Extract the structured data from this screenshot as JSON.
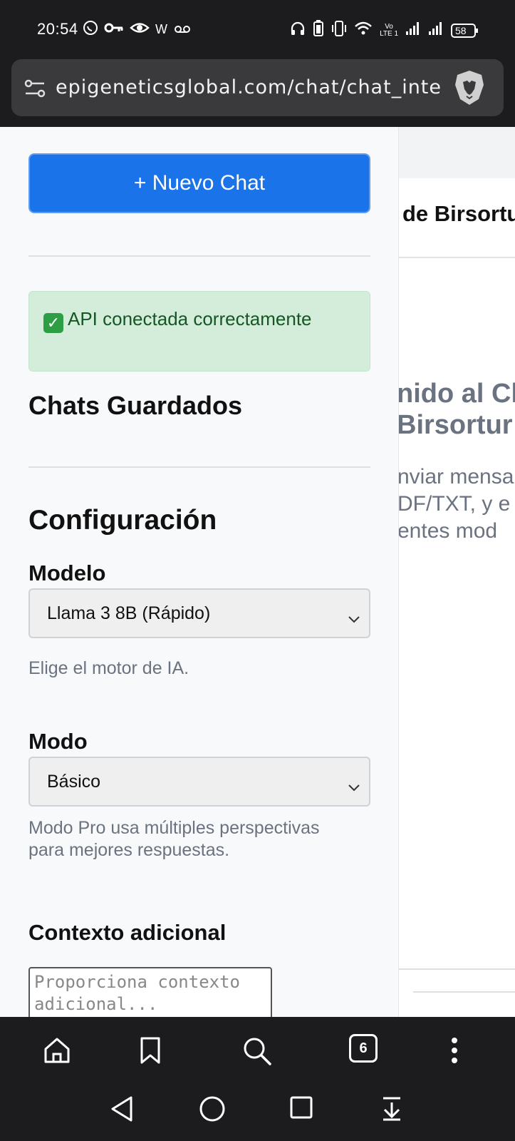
{
  "status_bar": {
    "time": "20:54",
    "left_icons": [
      "whatsapp-icon",
      "key-icon",
      "eye-icon",
      "w-letter-icon",
      "voicemail-icon"
    ],
    "w_letter": "W",
    "volte": "Vo",
    "lte": "LTE 1",
    "battery": "58"
  },
  "browser": {
    "url": "epigeneticsglobal.com/chat/chat_inte",
    "tab_count": "6"
  },
  "sidebar": {
    "new_chat_label": "+ Nuevo Chat",
    "api_status": "API conectada correctamente",
    "api_status_check": "✓",
    "saved_chats_heading": "Chats Guardados",
    "config_heading": "Configuración",
    "model_label": "Modelo",
    "model_selected": "Llama 3 8B (Rápido)",
    "model_help": "Elige el motor de IA.",
    "mode_label": "Modo",
    "mode_selected": "Básico",
    "mode_help_line1": "Modo Pro usa múltiples perspectivas",
    "mode_help_line2": "para mejores respuestas.",
    "context_label": "Contexto adicional",
    "context_placeholder_line1": "Proporciona contexto",
    "context_placeholder_line2": "adicional..."
  },
  "main": {
    "title_fragment": "de Birsortu",
    "welcome_line1": "nido al Ch",
    "welcome_line2": "Birsortur!",
    "text_line1": "nviar mensa",
    "text_line2": "DF/TXT, y e",
    "text_line3": "entes mod"
  },
  "colors": {
    "primary_button": "#1a73e8",
    "success_bg": "#d4edda",
    "success_text": "#155724",
    "muted_text": "#6b7280"
  }
}
